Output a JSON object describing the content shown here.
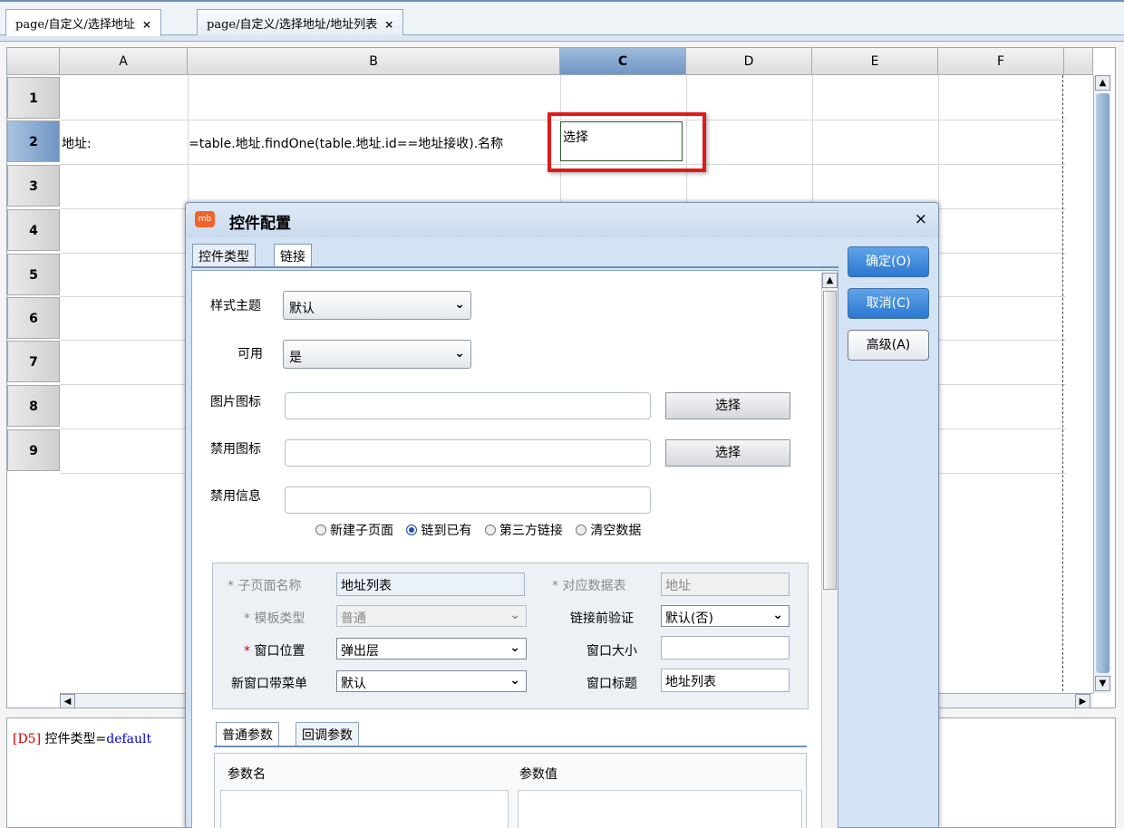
{
  "tabs": [
    {
      "label": "page/自定义/选择地址",
      "close": "×"
    },
    {
      "label": "page/自定义/选择地址/地址列表",
      "close": "×"
    }
  ],
  "sheet": {
    "columns": [
      "A",
      "B",
      "C",
      "D",
      "E",
      "F"
    ],
    "rows": [
      "1",
      "2",
      "3",
      "4",
      "5",
      "6",
      "7",
      "8",
      "9"
    ],
    "cells": {
      "a2": "地址:",
      "b2": "=table.地址.findOne(table.地址.id==地址接收).名称",
      "c2": "选择"
    }
  },
  "status": {
    "cell_ref": "[D5]",
    "prop": " 控件类型=",
    "value": "default"
  },
  "dialog": {
    "title": "控件配置",
    "close": "×",
    "tabs": [
      "控件类型",
      "链接"
    ],
    "buttons": {
      "ok": "确定(O)",
      "cancel": "取消(C)",
      "advanced": "高级(A)"
    },
    "fields": {
      "style_theme": {
        "label": "样式主题",
        "value": "默认"
      },
      "enabled": {
        "label": "可用",
        "value": "是"
      },
      "image_icon": {
        "label": "图片图标",
        "value": "",
        "button": "选择"
      },
      "disabled_icon": {
        "label": "禁用图标",
        "value": "",
        "button": "选择"
      },
      "disabled_info": {
        "label": "禁用信息",
        "value": ""
      }
    },
    "radios": {
      "options": [
        "新建子页面",
        "链到已有",
        "第三方链接",
        "清空数据"
      ],
      "selected": "链到已有"
    },
    "group": {
      "subpage_name": {
        "label": "* 子页面名称",
        "value": "地址列表"
      },
      "data_table": {
        "label": "* 对应数据表",
        "value": "地址"
      },
      "template_type": {
        "label": "* 模板类型",
        "value": "普通"
      },
      "pre_validate": {
        "label": "链接前验证",
        "value": "默认(否)"
      },
      "window_pos": {
        "star": "*",
        "label": " 窗口位置",
        "value": "弹出层"
      },
      "window_size": {
        "label": "窗口大小",
        "value": ""
      },
      "menu": {
        "label": "新窗口带菜单",
        "value": "默认"
      },
      "window_title": {
        "label": "窗口标题",
        "value": "地址列表"
      }
    },
    "param_tabs": [
      "普通参数",
      "回调参数"
    ],
    "param_table": {
      "headers": [
        "参数名",
        "参数值"
      ]
    }
  },
  "colors": {
    "accent": "#2c78d0",
    "highlight": "#e11a1a"
  }
}
